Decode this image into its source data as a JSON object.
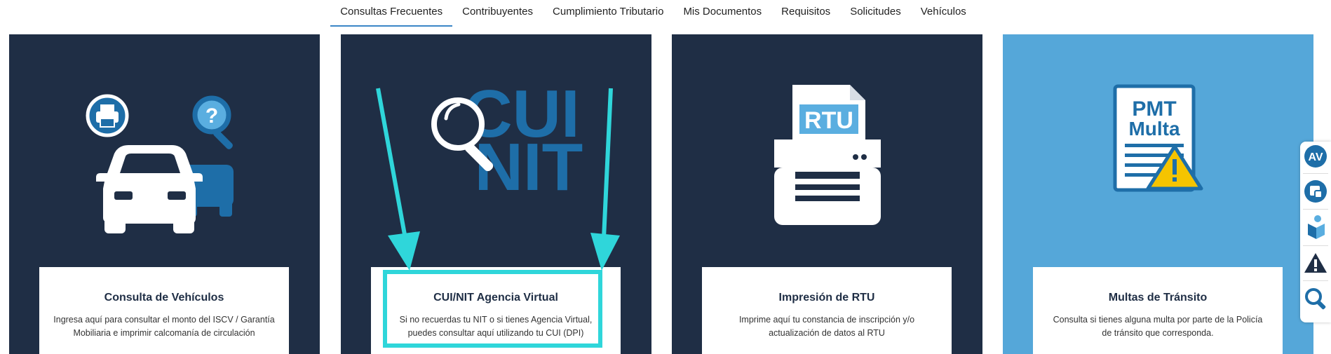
{
  "nav": {
    "items": [
      {
        "label": "Consultas Frecuentes",
        "active": true
      },
      {
        "label": "Contribuyentes"
      },
      {
        "label": "Cumplimiento Tributario"
      },
      {
        "label": "Mis Documentos"
      },
      {
        "label": "Requisitos"
      },
      {
        "label": "Solicitudes"
      },
      {
        "label": "Vehículos"
      }
    ]
  },
  "cards": [
    {
      "title": "Consulta de Vehículos",
      "description": "Ingresa aquí para consultar el monto del ISCV / Garantía Mobiliaria e imprimir calcomanía de circulación",
      "icon": "car-print-question-icon",
      "background": "#1f2e45"
    },
    {
      "title": "CUI/NIT Agencia Virtual",
      "description": "Si no recuerdas tu NIT o si tienes Agencia Virtual, puedes consultar aquí utilizando tu CUI (DPI)",
      "icon": "cui-nit-magnifier-icon",
      "illus_text_top": "CUI",
      "illus_text_bottom": "NIT",
      "background": "#1f2e45"
    },
    {
      "title": "Impresión de RTU",
      "description": "Imprime aquí tu constancia de inscripción y/o actualización de datos al RTU",
      "icon": "rtu-printer-icon",
      "illus_text": "RTU",
      "background": "#1f2e45"
    },
    {
      "title": "Multas de Tránsito",
      "description": "Consulta si tienes alguna multa por parte de la Policía de tránsito que corresponda.",
      "icon": "pmt-multa-document-icon",
      "illus_text_top": "PMT",
      "illus_text_bottom": "Multa",
      "background": "#55a7d9"
    }
  ],
  "floating_bar": {
    "items": [
      "agencia-virtual-icon",
      "declaraguate-icon",
      "cube-person-icon",
      "warning-icon",
      "search-icon"
    ]
  },
  "colors": {
    "dark_card": "#1f2e45",
    "light_card": "#55a7d9",
    "nav_underline": "#3b86c7",
    "highlight": "#2fd6da",
    "icon_blue": "#1e6ea8"
  }
}
